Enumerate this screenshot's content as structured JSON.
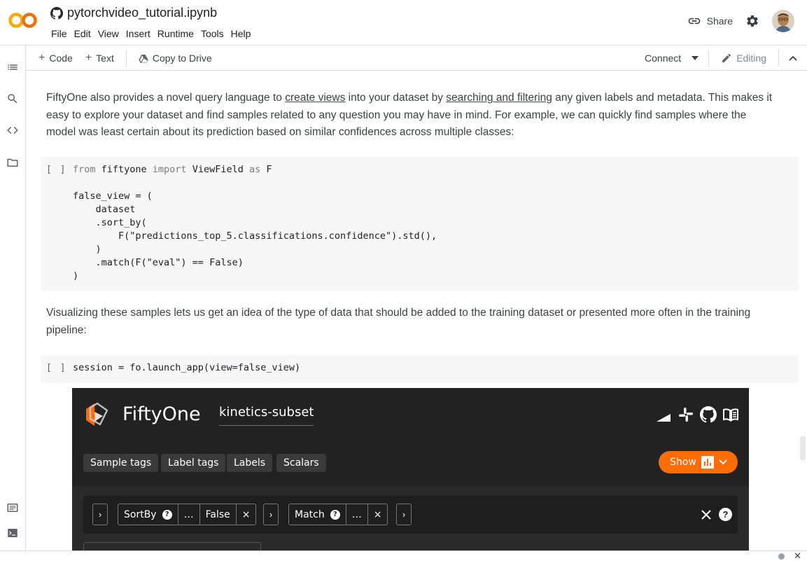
{
  "app": {
    "notebook_title": "pytorchvideo_tutorial.ipynb",
    "menu": [
      "File",
      "Edit",
      "View",
      "Insert",
      "Runtime",
      "Tools",
      "Help"
    ],
    "share_label": "Share"
  },
  "toolbar": {
    "code_label": "Code",
    "text_label": "Text",
    "copy_label": "Copy to Drive",
    "connect_label": "Connect",
    "editing_label": "Editing"
  },
  "cells": {
    "text1": {
      "part1": "FiftyOne also provides a novel query language to ",
      "link1": "create views",
      "part2": " into your dataset by ",
      "link2": "searching and filtering",
      "part3": " any given labels and metadata. This makes it easy to explore your dataset and find samples related to any question you may have in mind. For example, we can quickly find samples where the model was least certain about its prediction based on similar confidences across multiple classes:"
    },
    "code1": {
      "run_bracket": "[ ]",
      "lines": [
        "from fiftyone import ViewField as F",
        "",
        "false_view = (",
        "    dataset",
        "    .sort_by(",
        "        F(\"predictions_top_5.classifications.confidence\").std(),",
        "    )",
        "    .match(F(\"eval\") == False)",
        ")"
      ]
    },
    "text2": "Visualizing these samples lets us get an idea of the type of data that should be added to the training dataset or presented more often in the training pipeline:",
    "code2": {
      "run_bracket": "[ ]",
      "line": "session = fo.launch_app(view=false_view)"
    }
  },
  "fiftyone": {
    "brand": "FiftyOne",
    "dataset": "kinetics-subset",
    "tags": [
      "Sample tags",
      "Label tags",
      "Labels",
      "Scalars"
    ],
    "show_label": "Show",
    "accent": "#ff6d04",
    "stage1": {
      "name": "SortBy",
      "ellipsis": "…",
      "value": "False",
      "close": "×"
    },
    "stage2": {
      "name": "Match",
      "ellipsis": "…",
      "close": "×"
    },
    "arrow": "›"
  }
}
